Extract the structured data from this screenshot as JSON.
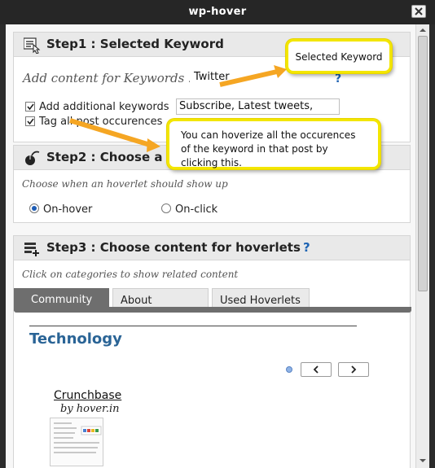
{
  "window": {
    "title": "wp-hover"
  },
  "step1": {
    "title": "Step1 : Selected Keyword",
    "add_content_label": "Add content for Keywords :",
    "keyword_value": "Twitter",
    "help": "?",
    "additional_label": "Add additional keywords",
    "additional_checked": true,
    "additional_value": "Subscribe, Latest tweets,",
    "tag_all_label": "Tag all post occurences",
    "tag_all_checked": true
  },
  "step2": {
    "title": "Step2 : Choose a",
    "instruction": "Choose when an hoverlet should show up",
    "options": [
      {
        "label": "On-hover",
        "selected": true
      },
      {
        "label": "On-click",
        "selected": false
      }
    ]
  },
  "step3": {
    "title": "Step3 : Choose content for hoverlets",
    "help": "?",
    "instruction": "Click on categories to show related content",
    "tabs": [
      {
        "label": "Community",
        "active": true
      },
      {
        "label": "About",
        "active": false
      },
      {
        "label": "Used Hoverlets",
        "active": false
      }
    ],
    "category": "Technology",
    "nav_prev": "<",
    "nav_next": ">",
    "item": {
      "name": "Crunchbase",
      "byline": "by hover.in"
    }
  },
  "callouts": {
    "keyword": "Selected Keyword",
    "hoverize": "You can hoverize all the occurences of the keyword in that post by clicking this."
  },
  "colors": {
    "callout_border": "#f3e600",
    "arrow": "#f5a623",
    "link_blue": "#2a6496",
    "titlebar": "#262626"
  },
  "icons": [
    "close-icon",
    "pointer-hand-icon",
    "mouse-icon",
    "list-add-icon",
    "help-icon",
    "arrow-icon",
    "chevron-left-icon",
    "chevron-right-icon"
  ]
}
